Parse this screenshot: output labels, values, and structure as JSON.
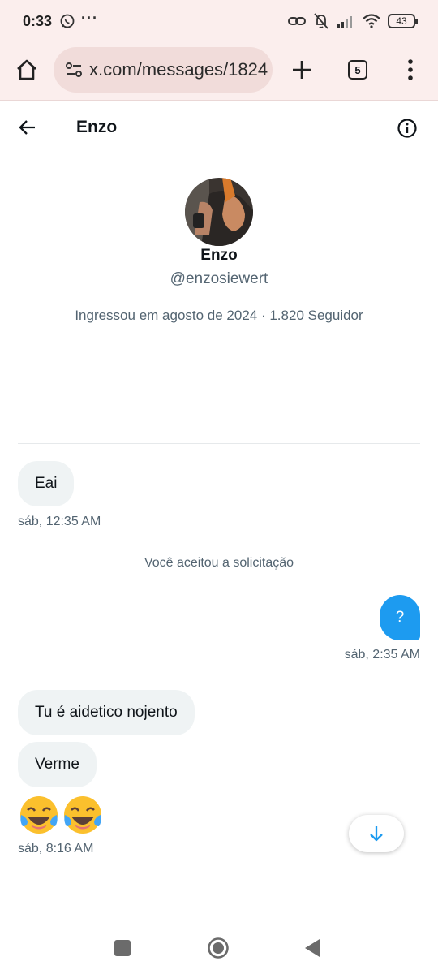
{
  "status_bar": {
    "time": "0:33",
    "battery": "43"
  },
  "browser": {
    "url": "x.com/messages/1824",
    "tab_count": "5"
  },
  "header": {
    "title": "Enzo"
  },
  "profile": {
    "name": "Enzo",
    "handle": "@enzosiewert",
    "meta": "Ingressou em agosto de 2024 · 1.820 Seguidor"
  },
  "messages": {
    "m1": {
      "text": "Eai",
      "time": "sáb, 12:35 AM"
    },
    "system": "Você aceitou a solicitação",
    "m2": {
      "text": "?",
      "time": "sáb, 2:35 AM"
    },
    "m3": {
      "text": "Tu é aidetico nojento"
    },
    "m4": {
      "text": "Verme"
    },
    "m5": {
      "emoji": "😂😂",
      "time": "sáb, 8:16 AM"
    }
  },
  "icons": {
    "status": [
      "whatsapp-icon",
      "link-icon",
      "bell-off-icon",
      "signal-icon",
      "wifi-icon",
      "battery-icon"
    ],
    "browser": [
      "home-icon",
      "site-settings-icon",
      "new-tab-icon",
      "tabs-icon",
      "overflow-menu-icon"
    ],
    "header": [
      "back-arrow-icon",
      "info-icon"
    ],
    "nav": [
      "recents-icon",
      "home-nav-icon",
      "back-nav-icon"
    ]
  },
  "colors": {
    "accent": "#1d9bf0",
    "bubble_in": "#eff3f4",
    "browser_bg": "#fbeeed",
    "secondary_text": "#536471"
  }
}
